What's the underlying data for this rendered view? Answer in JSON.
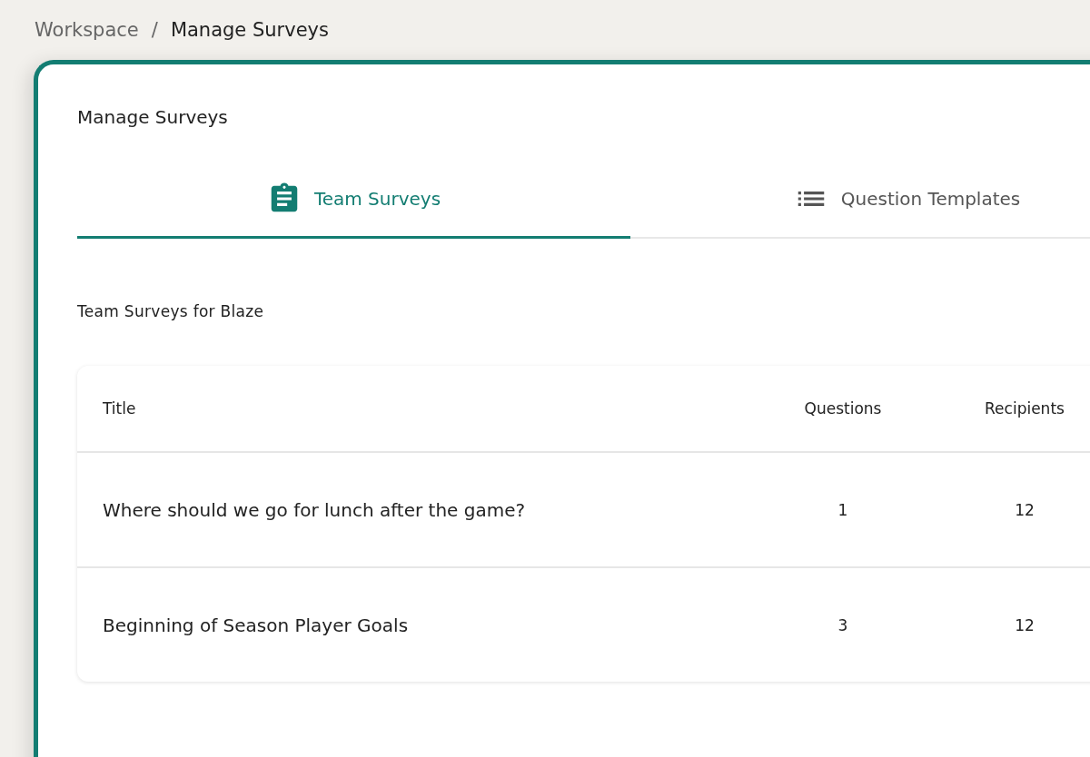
{
  "breadcrumb_separator": "/",
  "breadcrumb": [
    {
      "label": "Workspace",
      "current": false
    },
    {
      "label": "Manage Surveys",
      "current": true
    }
  ],
  "panel": {
    "title": "Manage Surveys",
    "tabs": [
      {
        "label": "Team Surveys",
        "kind": "clipboard",
        "selected": true
      },
      {
        "label": "Question Templates",
        "kind": "list",
        "selected": false
      }
    ],
    "section_title": "Team Surveys for Blaze",
    "table": {
      "columns": [
        "Title",
        "Questions",
        "Recipients"
      ],
      "rows": [
        {
          "title": "Where should we go for lunch after the game?",
          "questions": "1",
          "recipients": "12"
        },
        {
          "title": "Beginning of Season Player Goals",
          "questions": "3",
          "recipients": "12"
        }
      ]
    }
  }
}
